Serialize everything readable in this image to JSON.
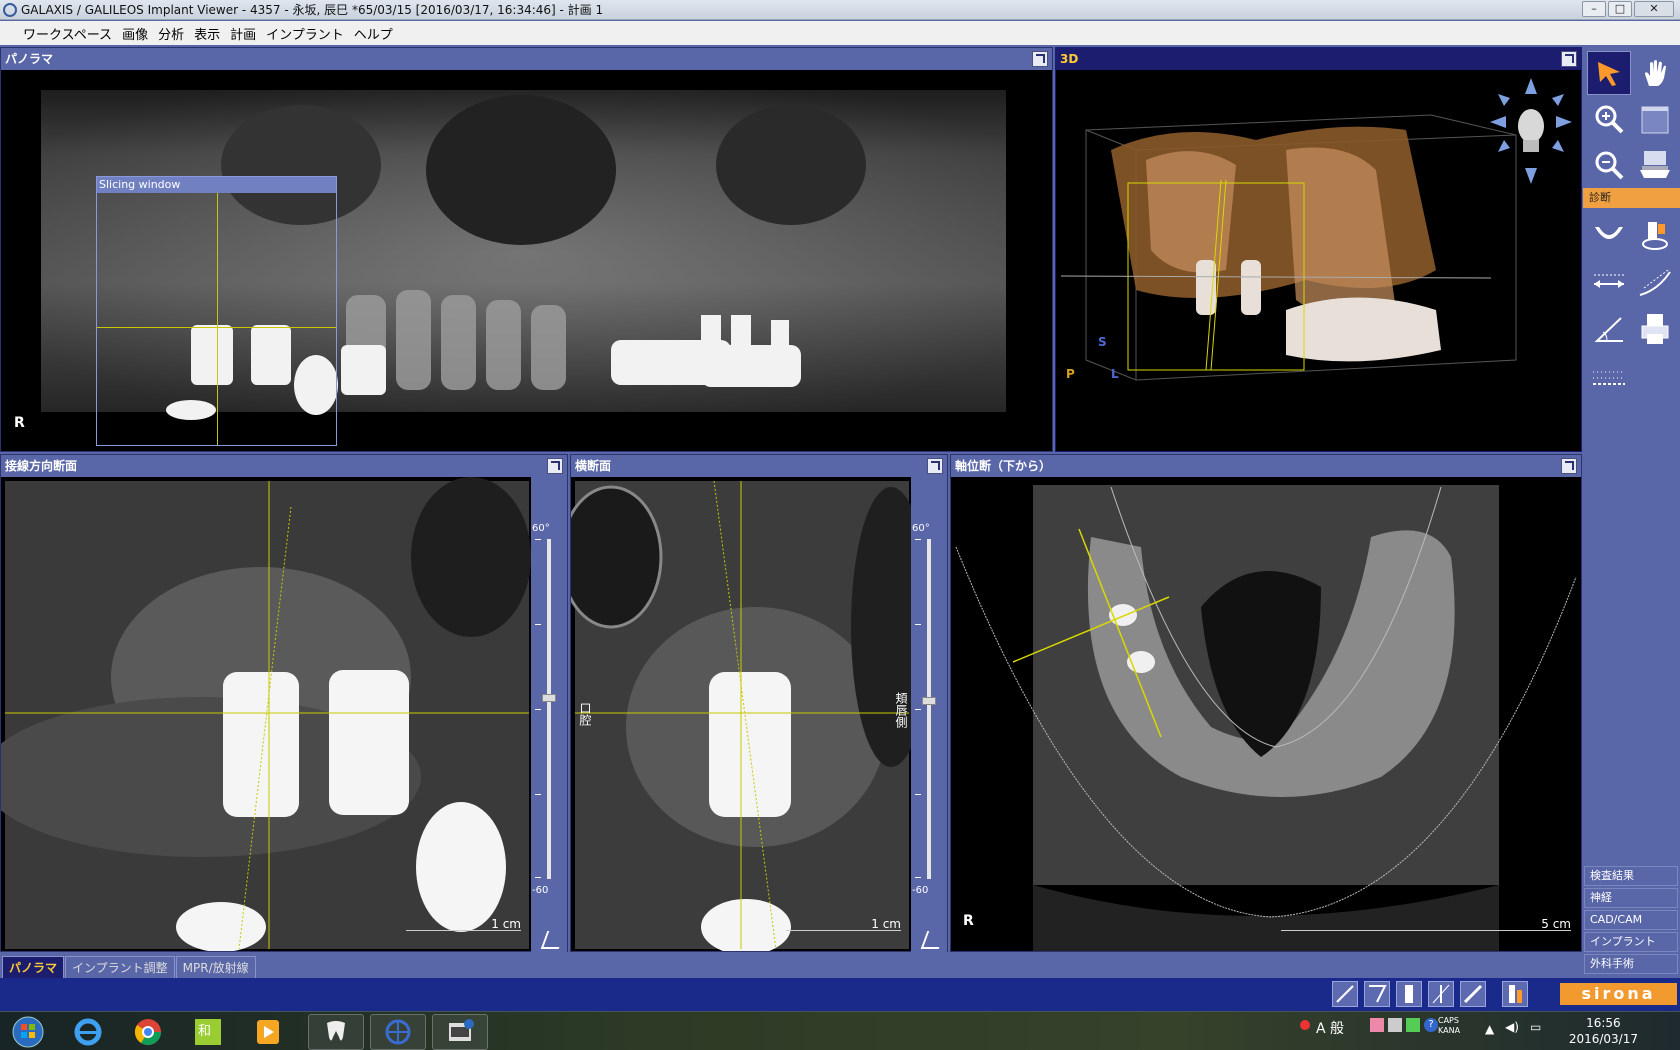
{
  "window": {
    "title": "GALAXIS / GALILEOS Implant Viewer - 4357 - 永坂, 辰巳 *65/03/15 [2016/03/17, 16:34:46] - 計画 1",
    "buttons": {
      "minimize": "–",
      "maximize": "□",
      "close": "✕"
    }
  },
  "menu": [
    "ワークスペース",
    "画像",
    "分析",
    "表示",
    "計画",
    "インプラント",
    "ヘルプ"
  ],
  "panels": {
    "panorama": {
      "title": "パノラマ",
      "r_label": "R",
      "slicing_window": "Slicing window"
    },
    "view3d": {
      "title": "3D",
      "axes": {
        "s": "S",
        "p": "P",
        "l": "L"
      }
    },
    "tangential": {
      "title": "接線方向断面",
      "scale": "1 cm",
      "slider_top": "60°",
      "slider_bottom": "-60"
    },
    "cross": {
      "title": "横断面",
      "scale": "1 cm",
      "slider_top": "60°",
      "slider_bottom": "-60",
      "left_side": "口腔",
      "right_side": "頬唇側"
    },
    "axial": {
      "title": "軸位断（下から）",
      "scale": "5 cm",
      "r_label": "R"
    }
  },
  "sidebar": {
    "section_label": "診断",
    "tabs": [
      "検査結果",
      "神経",
      "CAD/CAM",
      "インプラント",
      "外科手術"
    ],
    "tools": [
      "pointer-icon",
      "hand-icon",
      "zoom-in-icon",
      "panel-icon",
      "zoom-out-icon",
      "tray-icon",
      "arch-icon",
      "implant-head-icon",
      "measure-icon",
      "curve-measure-icon",
      "angle-icon",
      "printer-icon",
      "ruler-icon"
    ]
  },
  "bottom_tabs": [
    "パノラマ",
    "インプラント調整",
    "MPR/放射線"
  ],
  "status": {
    "brand": "sirona",
    "icons": [
      "pano-tool-1",
      "pano-tool-2",
      "pano-tool-3",
      "pano-tool-4",
      "pano-tool-5",
      "implant-tool"
    ]
  },
  "taskbar": {
    "clock_time": "16:56",
    "clock_date": "2016/03/17",
    "ime": "A 般",
    "caps": "CAPS",
    "kana": "KANA",
    "apps": [
      "start-orb",
      "ie-icon",
      "chrome-icon",
      "wa-icon",
      "media-icon",
      "tooth-app-icon",
      "galaxis-icon",
      "viewer-icon"
    ]
  }
}
